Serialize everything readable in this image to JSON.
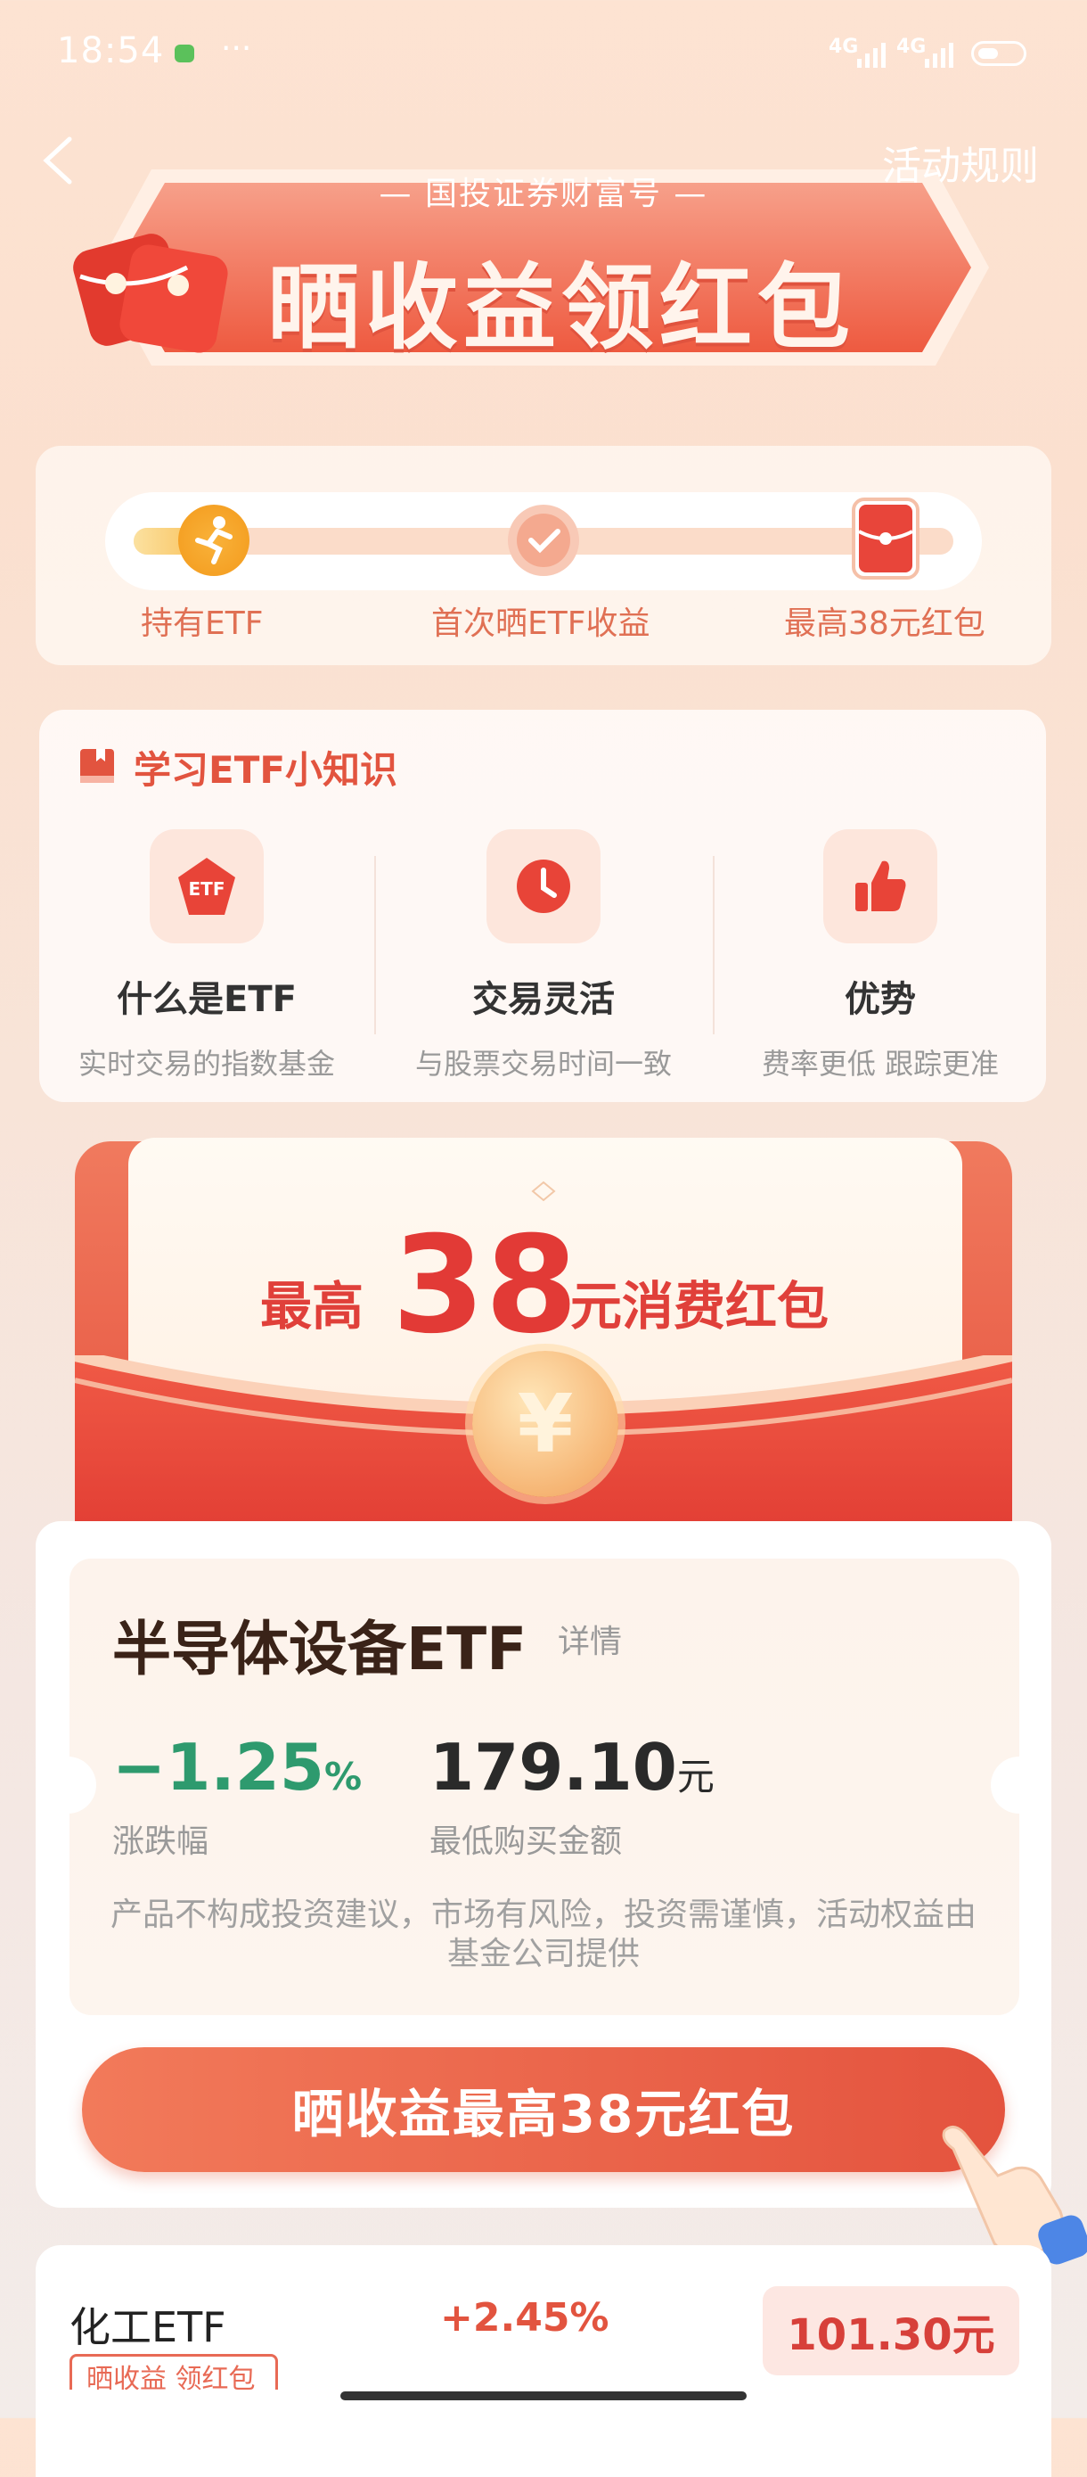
{
  "status_bar": {
    "time": "18:54",
    "dots": "···",
    "signal1": "4G",
    "signal2": "4G"
  },
  "header": {
    "rules_label": "活动规则",
    "subtitle": "— 国投证券财富号 —",
    "title": "晒收益领红包"
  },
  "progress": {
    "steps": [
      {
        "label": "持有ETF"
      },
      {
        "label": "首次晒ETF收益"
      },
      {
        "label": "最高38元红包"
      }
    ]
  },
  "learn": {
    "title": "学习ETF小知识",
    "items": [
      {
        "icon_text": "ETF",
        "title": "什么是ETF",
        "sub": "实时交易的指数基金"
      },
      {
        "title": "交易灵活",
        "sub": "与股票交易时间一致"
      },
      {
        "title": "优势",
        "sub": "费率更低 跟踪更准"
      }
    ]
  },
  "packet": {
    "prefix": "最高",
    "amount": "38",
    "suffix": "元消费红包",
    "coin": "¥"
  },
  "product": {
    "name": "半导体设备ETF",
    "detail": "详情",
    "change": "−1.25",
    "change_unit": "%",
    "change_label": "涨跌幅",
    "min_amount": "179.10",
    "min_unit": "元",
    "min_label": "最低购买金额",
    "disclaimer": "产品不构成投资建议，市场有风险，投资需谨慎，活动权益由基金公司提供",
    "cta": "晒收益最高38元红包"
  },
  "next_product": {
    "name": "化工ETF",
    "change": "+2.45%",
    "price": "101.30元",
    "tag": "晒收益 领红包"
  },
  "colors": {
    "accent": "#e4533e",
    "positive": "#e2543f",
    "negative": "#2e9a6e"
  }
}
